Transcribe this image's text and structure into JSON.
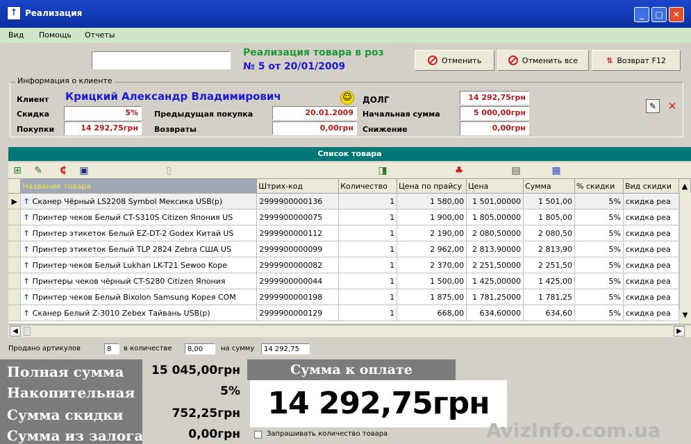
{
  "window": {
    "title": "Реализация",
    "app_icon": "↑"
  },
  "menu": [
    "Вид",
    "Помощь",
    "Отчеты"
  ],
  "header": {
    "line1": "Реализация товара в роз",
    "line2": "№ 5 от 20/01/2009",
    "search_value": ""
  },
  "buttons": {
    "cancel": "Отменить",
    "cancel_all": "Отменить все",
    "return": "Возврат F12"
  },
  "client_group_label": "Информация о клиенте",
  "client": {
    "label_client": "Клиент",
    "name": "Крицкий Александр Владимирович",
    "label_discount": "Скидка",
    "discount": "5%",
    "label_purchases": "Покупки",
    "purchases": "14 292,75грн",
    "label_prev": "Предыдущая покупка",
    "prev": "20.01.2009",
    "label_returns": "Возвраты",
    "returns": "0,00грн",
    "label_debt": "долг",
    "debt": "14 292,75грн",
    "label_initial": "Начальная сумма",
    "initial": "5 000,00грн",
    "label_reduction": "Снижение",
    "reduction": "0,00грн"
  },
  "goods_section": "Список товара",
  "grid": {
    "columns": [
      "Название товара",
      "Штрих-код",
      "Количество",
      "Цена по прайсу",
      "Цена",
      "Сумма",
      "% скидки",
      "Вид скидки"
    ],
    "rows": [
      {
        "name": "Сканер Чёрный LS2208 Symbol Мексика USB(p)",
        "code": "2999900000136",
        "qty": "1",
        "list": "1 580,00",
        "price": "1 501,00000",
        "sum": "1 501,00",
        "pct": "5%",
        "kind": "скидка реа"
      },
      {
        "name": "Принтер чеков Белый CT-S310S Citizen Япония US",
        "code": "2999900000075",
        "qty": "1",
        "list": "1 900,00",
        "price": "1 805,00000",
        "sum": "1 805,00",
        "pct": "5%",
        "kind": "скидка реа"
      },
      {
        "name": "Принтер этикеток Белый EZ-DT-2 Godex Китай US",
        "code": "2999900000112",
        "qty": "1",
        "list": "2 190,00",
        "price": "2 080,50000",
        "sum": "2 080,50",
        "pct": "5%",
        "kind": "скидка реа"
      },
      {
        "name": "Принтер этикеток Белый TLP 2824 Zebra США US",
        "code": "2999900000099",
        "qty": "1",
        "list": "2 962,00",
        "price": "2 813,90000",
        "sum": "2 813,90",
        "pct": "5%",
        "kind": "скидка реа"
      },
      {
        "name": "Принтер чеков Белый Lukhan LK-T21 Sewoo Kope",
        "code": "2999900000082",
        "qty": "1",
        "list": "2 370,00",
        "price": "2 251,50000",
        "sum": "2 251,50",
        "pct": "5%",
        "kind": "скидка реа"
      },
      {
        "name": "Принтеры чеков чёрный CT-S280 Citizen Япония",
        "code": "2999900000044",
        "qty": "1",
        "list": "1 500,00",
        "price": "1 425,00000",
        "sum": "1 425,00",
        "pct": "5%",
        "kind": "скидка реа"
      },
      {
        "name": "Принтер чеков Белый Bixolon Samsung Корея COM",
        "code": "2999900000198",
        "qty": "1",
        "list": "1 875,00",
        "price": "1 781,25000",
        "sum": "1 781,25",
        "pct": "5%",
        "kind": "скидка реа"
      },
      {
        "name": "Сканер Белый Z-3010 Zebex Тайвань USB(p)",
        "code": "2999900000129",
        "qty": "1",
        "list": "668,00",
        "price": "634,60000",
        "sum": "634,60",
        "pct": "5%",
        "kind": "скидка реа"
      }
    ]
  },
  "status": {
    "sold_label": "Продано артикулов",
    "sold": "8",
    "qty_label": "в количестве",
    "qty": "8,00",
    "sum_label": "на сумму",
    "sum": "14 292,75"
  },
  "totals": {
    "full_label": "Полная сумма",
    "full": "15 045,00грн",
    "accum_label": "Накопительная с",
    "accum": "5%",
    "discount_label": "Сумма скидки",
    "discount": "752,25грн",
    "deposit_label": "Сумма из залога",
    "deposit": "0,00грн",
    "pay_label": "Сумма к оплате",
    "pay": "14 292,75грн",
    "ask_qty": "Запрашивать количество товара"
  },
  "watermark": "AvizInfo.com.ua"
}
